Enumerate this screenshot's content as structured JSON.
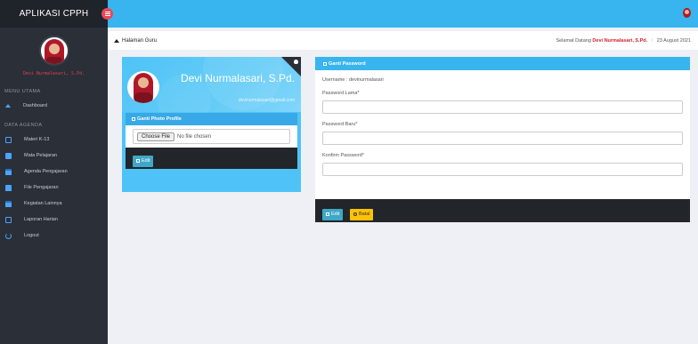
{
  "app": {
    "title": "APLIKASI CPPH"
  },
  "sidebar": {
    "username": "Devi Nurmalasari, S.Pd.",
    "section_main": "MENU UTAMA",
    "section_agenda": "DATA AGENDA",
    "items": [
      {
        "label": "Dashboard",
        "icon": "home-icon"
      },
      {
        "label": "Materi K-13",
        "icon": "folder-icon"
      },
      {
        "label": "Mata Pelajaran",
        "icon": "book-icon"
      },
      {
        "label": "Agenda Pengajaran",
        "icon": "calendar-icon"
      },
      {
        "label": "File Pengajaran",
        "icon": "folder-open-icon"
      },
      {
        "label": "Kegiatan Lainnya",
        "icon": "calendar-icon"
      },
      {
        "label": "Laporan Harian",
        "icon": "print-icon"
      },
      {
        "label": "Logout",
        "icon": "power-icon"
      }
    ]
  },
  "breadcrumb": {
    "page": "Halaman Guru",
    "welcome_prefix": "Selamat Datang",
    "welcome_name": "Devi Nurmalasari, S.Pd.",
    "separator": "/",
    "date": "23 August 2021"
  },
  "profile": {
    "name": "Devi Nurmalasari, S.Pd.",
    "email": "devinurmalasari@gmail.com",
    "photo_section_title": "Ganti Photo Profile",
    "file_button": "Choose File",
    "file_status": "No file chosen",
    "edit_button": "Edit"
  },
  "password": {
    "section_title": "Ganti Password",
    "username_label": "Username : devinurmalasari",
    "old_label": "Password Lama*",
    "new_label": "Password Baru*",
    "confirm_label": "Konfirm Password*",
    "edit_button": "Edit",
    "cancel_button": "Batal"
  },
  "colors": {
    "topbar": "#38b5ee",
    "sidebar": "#2a2f38",
    "accent_red": "#d12030",
    "edit_button": "#3fa7c7",
    "cancel_button": "#ffc107"
  }
}
